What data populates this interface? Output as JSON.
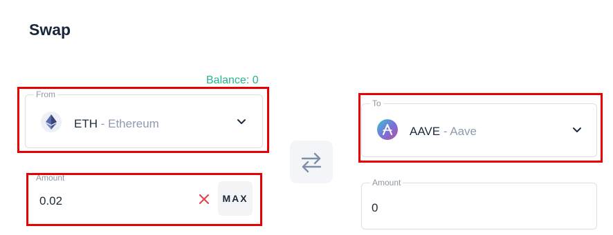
{
  "title": "Swap",
  "balance": "Balance: 0",
  "from": {
    "label": "From",
    "symbol": "ETH",
    "separator": " - ",
    "name": "Ethereum"
  },
  "to": {
    "label": "To",
    "symbol": "AAVE",
    "separator": " - ",
    "name": "Aave"
  },
  "amount_in": {
    "label": "Amount",
    "value": "0.02",
    "max_label": "MAX"
  },
  "amount_out": {
    "label": "Amount",
    "value": "0"
  },
  "colors": {
    "balance": "#21b690",
    "highlight": "#e60000",
    "clear": "#e8434f"
  },
  "icons": [
    "ethereum-icon",
    "aave-icon",
    "chevron-down-icon",
    "clear-icon",
    "swap-arrows-icon"
  ]
}
